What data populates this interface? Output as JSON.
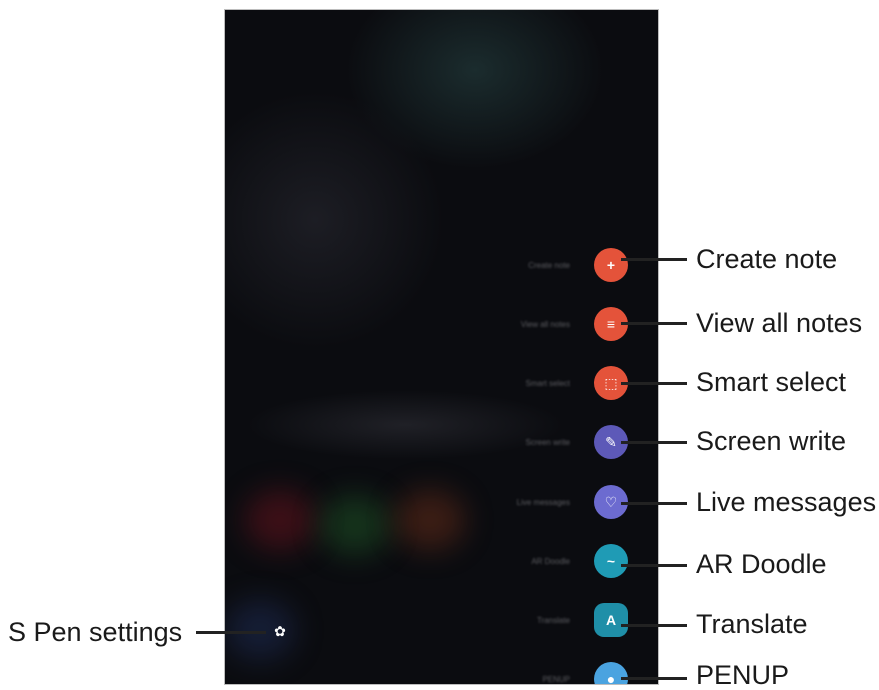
{
  "menu": {
    "items": [
      {
        "screen_label": "Create note",
        "callout": "Create note",
        "color": "#e4533a",
        "icon": "plus-note-icon",
        "glyph": "+"
      },
      {
        "screen_label": "View all notes",
        "callout": "View all notes",
        "color": "#e4533a",
        "icon": "notes-list-icon",
        "glyph": "≡"
      },
      {
        "screen_label": "Smart select",
        "callout": "Smart select",
        "color": "#e4533a",
        "icon": "select-icon",
        "glyph": "⬚"
      },
      {
        "screen_label": "Screen write",
        "callout": "Screen write",
        "color": "#5d59b8",
        "icon": "pen-write-icon",
        "glyph": "✎"
      },
      {
        "screen_label": "Live messages",
        "callout": "Live messages",
        "color": "#6c6bd0",
        "icon": "heart-icon",
        "glyph": "♡"
      },
      {
        "screen_label": "AR Doodle",
        "callout": "AR Doodle",
        "color": "#1f9bb5",
        "icon": "doodle-icon",
        "glyph": "~"
      },
      {
        "screen_label": "Translate",
        "callout": "Translate",
        "color": "#1f8fa8",
        "icon": "translate-icon",
        "glyph": "A"
      },
      {
        "screen_label": "PENUP",
        "callout": "PENUP",
        "color": "#4aa3e0",
        "icon": "penup-icon",
        "glyph": "●"
      }
    ]
  },
  "settings": {
    "callout": "S Pen settings",
    "icon": "gear-icon",
    "glyph": "✿"
  }
}
